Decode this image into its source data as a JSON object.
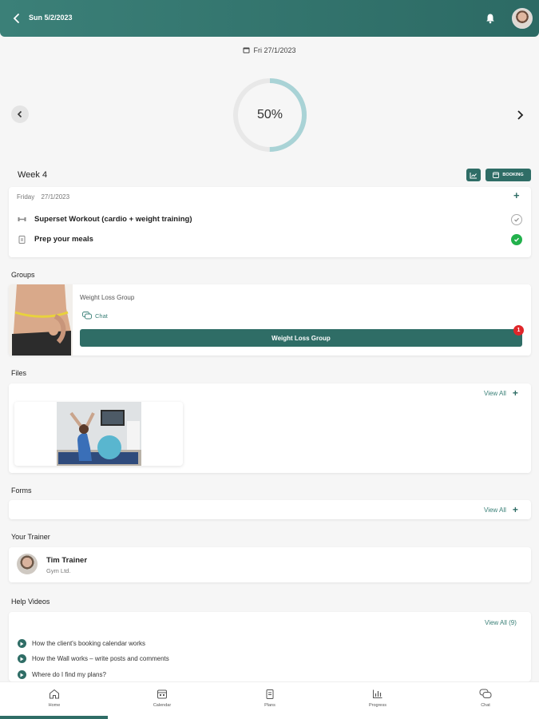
{
  "header": {
    "title": "Sun 5/2/2023"
  },
  "date_label": "Fri 27/1/2023",
  "progress": {
    "percent": 50,
    "label": "50%"
  },
  "week": {
    "title": "Week 4",
    "booking_label": "BOOKING"
  },
  "day_card": {
    "day": "Friday",
    "date": "27/1/2023",
    "tasks": [
      {
        "label": "Superset Workout (cardio + weight training)",
        "done": false
      },
      {
        "label": "Prep your meals",
        "done": true
      }
    ]
  },
  "groups": {
    "title": "Groups",
    "group_name": "Weight Loss Group",
    "chat_label": "Chat",
    "button_label": "Weight Loss Group",
    "badge": "1"
  },
  "files": {
    "title": "Files",
    "view_all": "View All"
  },
  "forms": {
    "title": "Forms",
    "view_all": "View All"
  },
  "trainer": {
    "section_title": "Your Trainer",
    "name": "Tim Trainer",
    "company": "Gym Ltd."
  },
  "help": {
    "title": "Help Videos",
    "view_all": "View All (9)",
    "videos": [
      "How the client's booking calendar works",
      "How the Wall works – write posts and comments",
      "Where do I find my plans?"
    ]
  },
  "nav": [
    "Home",
    "Calendar",
    "Plans",
    "Progress",
    "Chat"
  ],
  "colors": {
    "primary": "#2f6d66",
    "header": "#3b8078",
    "ring": "#a9d3d6",
    "done": "#22b14c"
  }
}
